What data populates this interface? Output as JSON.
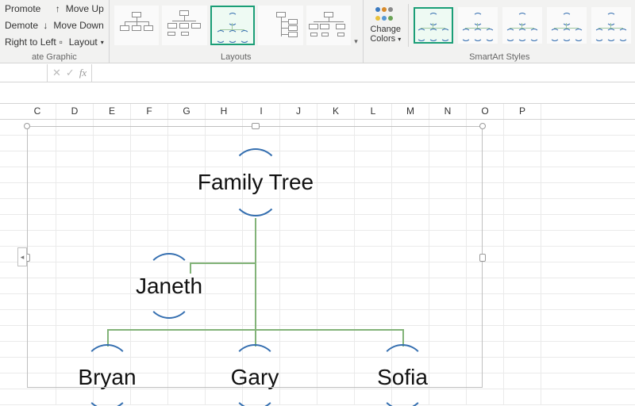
{
  "ribbon": {
    "createGraphic": {
      "promote": "Promote",
      "demote": "Demote",
      "rightToLeft": "Right to Left",
      "moveUp": "Move Up",
      "moveDown": "Move Down",
      "layout": "Layout",
      "groupLabel": "ate Graphic"
    },
    "layouts": {
      "groupLabel": "Layouts"
    },
    "styles": {
      "groupLabel": "SmartArt Styles",
      "changeColors1": "Change",
      "changeColors2": "Colors"
    }
  },
  "formulaBar": {
    "fx": "fx"
  },
  "columns": [
    "C",
    "D",
    "E",
    "F",
    "G",
    "H",
    "I",
    "J",
    "K",
    "L",
    "M",
    "N",
    "O",
    "P"
  ],
  "chart_data": {
    "type": "hierarchy",
    "root": {
      "label": "Family Tree"
    },
    "assistant": {
      "label": "Janeth"
    },
    "children": [
      {
        "label": "Bryan"
      },
      {
        "label": "Gary"
      },
      {
        "label": "Sofia"
      }
    ]
  }
}
